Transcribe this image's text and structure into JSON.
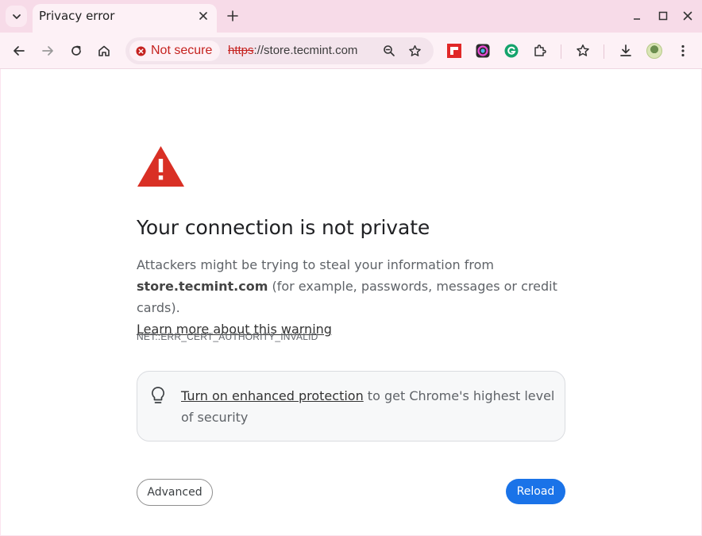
{
  "tab": {
    "title": "Privacy error"
  },
  "omnibox": {
    "security_chip": "Not secure",
    "url_scheme": "https",
    "url_rest": "://store.tecmint.com"
  },
  "icons": {
    "back": "back-arrow-icon",
    "forward": "forward-arrow-icon",
    "reload": "reload-icon",
    "home": "home-icon",
    "zoom": "zoom-icon",
    "bookmark": "star-icon",
    "extensions": [
      "flipboard-icon",
      "color-picker-icon",
      "grammarly-icon",
      "puzzle-icon"
    ],
    "download": "download-icon",
    "menu": "more-vert-icon"
  },
  "colors": {
    "accent": "#1a73e8",
    "danger": "#c5221f",
    "warning_icon": "#d93025"
  },
  "content": {
    "heading": "Your connection is not private",
    "para_intro": "Attackers might be trying to steal your information from ",
    "host": "store.tecmint.com",
    "para_examples": " (for example, passwords, messages or credit cards).",
    "learn_more": "Learn more about this warning",
    "error_code": "NET::ERR_CERT_AUTHORITY_INVALID",
    "protection_link": "Turn on enhanced protection",
    "protection_text": " to get Chrome's highest level of security",
    "advanced_button": "Advanced",
    "reload_button": "Reload"
  }
}
